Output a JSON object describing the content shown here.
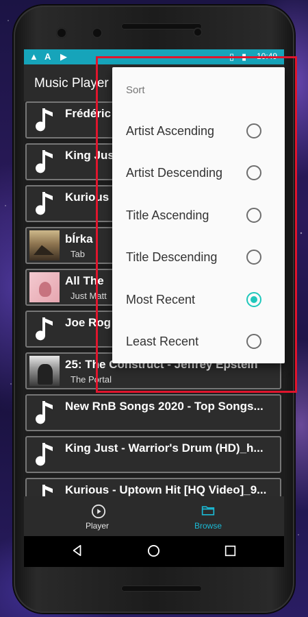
{
  "status_bar": {
    "time": "10:49",
    "icons": [
      "warning-icon",
      "app-a-icon",
      "play-circle-icon",
      "vibrate-icon",
      "battery-icon"
    ]
  },
  "app": {
    "title": "Music Player"
  },
  "tracks": [
    {
      "title": "Frédéric",
      "subtitle": "",
      "art": "music-note-icon"
    },
    {
      "title": "King Just",
      "subtitle": "",
      "art": "music-note-icon"
    },
    {
      "title": "Kurious",
      "subtitle": "",
      "art": "music-note-icon"
    },
    {
      "title": "bÍrka",
      "subtitle": "Tab",
      "art": "album-art"
    },
    {
      "title": "All The",
      "subtitle": "Just Matt",
      "art": "album-art"
    },
    {
      "title": "Joe Rog",
      "subtitle": "",
      "art": "music-note-icon"
    },
    {
      "title": "25: The Construct - Jeffrey Epstein",
      "subtitle": "The Portal",
      "art": "album-art"
    },
    {
      "title": "New RnB Songs 2020 - Top Songs...",
      "subtitle": "",
      "art": "music-note-icon"
    },
    {
      "title": "King Just - Warrior's Drum (HD)_h...",
      "subtitle": "",
      "art": "music-note-icon"
    },
    {
      "title": "Kurious - Uptown Hit [HQ Video]_9...",
      "subtitle": "",
      "art": "music-note-icon"
    }
  ],
  "bottom_nav": {
    "player": {
      "label": "Player",
      "icon": "play-circle-icon",
      "active": false
    },
    "browse": {
      "label": "Browse",
      "icon": "folder-icon",
      "active": true
    }
  },
  "sort_menu": {
    "header": "Sort",
    "options": [
      {
        "label": "Artist Ascending",
        "selected": false
      },
      {
        "label": "Artist Descending",
        "selected": false
      },
      {
        "label": "Title Ascending",
        "selected": false
      },
      {
        "label": "Title Descending",
        "selected": false
      },
      {
        "label": "Most Recent",
        "selected": true
      },
      {
        "label": "Least Recent",
        "selected": false
      }
    ]
  },
  "colors": {
    "accent": "#1fc7bb",
    "status_bar": "#16a4ba",
    "highlight": "#e0152d",
    "active_nav": "#1bb9d4"
  }
}
